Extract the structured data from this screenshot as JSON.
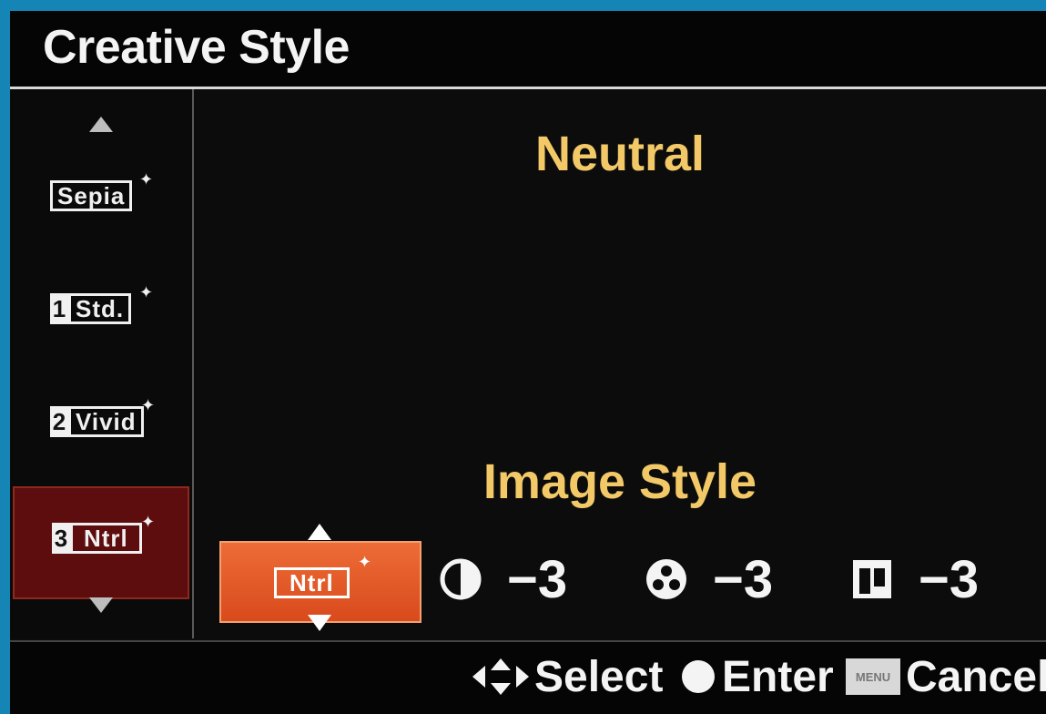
{
  "title": "Creative Style",
  "sidebar": {
    "items": [
      {
        "number": "",
        "label": "Sepia",
        "selected": false
      },
      {
        "number": "1",
        "label": "Std.",
        "selected": false
      },
      {
        "number": "2",
        "label": "Vivid",
        "selected": false
      },
      {
        "number": "3",
        "label": "Ntrl",
        "selected": true
      }
    ],
    "sparkle": "✦"
  },
  "main": {
    "style_name": "Neutral",
    "section_label": "Image Style",
    "picker_label": "Ntrl",
    "params": [
      {
        "icon": "contrast-icon",
        "value": "−3"
      },
      {
        "icon": "saturation-icon",
        "value": "−3"
      },
      {
        "icon": "sharpness-icon",
        "value": "−3"
      }
    ]
  },
  "footer": {
    "select_label": "Select",
    "enter_label": "Enter",
    "menu_key": "MENU",
    "cancel_label": "Cancel"
  },
  "colors": {
    "accent_text": "#f3c968",
    "selected_bg": "#5e0d0e",
    "picker_bg": "#e25a26",
    "frame": "#1485b4"
  }
}
